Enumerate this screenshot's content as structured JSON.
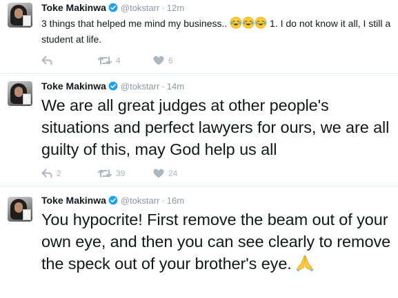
{
  "tweets": [
    {
      "name": "Toke Makinwa",
      "handle": "@tokstarr",
      "time": "12m",
      "text_before": "3 things that helped me mind my business.. ",
      "text_after": " 1. I do not know it all, I  still a student at life.",
      "emojis": [
        "face-with-tears-of-joy",
        "face-with-tears-of-joy",
        "face-with-tears-of-joy"
      ],
      "reply_count": "",
      "retweet_count": "4",
      "like_count": "6"
    },
    {
      "name": "Toke Makinwa",
      "handle": "@tokstarr",
      "time": "14m",
      "text": "We are all great judges at other people's situations and perfect lawyers for ours, we are all guilty of this, may God help us all",
      "reply_count": "2",
      "retweet_count": "39",
      "like_count": "24"
    },
    {
      "name": "Toke Makinwa",
      "handle": "@tokstarr",
      "time": "16m",
      "text": "You hypocrite! First remove the beam out of your own eye, and then you can see clearly to remove the speck out of your brother's eye. ",
      "emojis": [
        "folded-hands"
      ]
    }
  ],
  "colors": {
    "verified": "#1da1f2",
    "muted": "#8a9aa6",
    "action_icon": "#aab8c2",
    "divider": "#e1e8ed"
  }
}
